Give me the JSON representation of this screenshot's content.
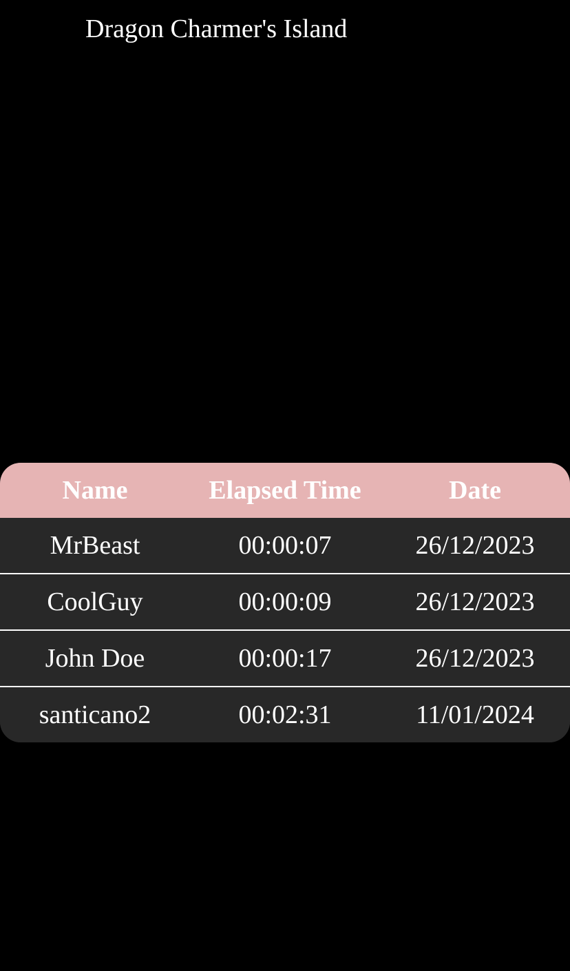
{
  "title": "Dragon Charmer's Island",
  "leaderboard": {
    "columns": {
      "name": "Name",
      "time": "Elapsed Time",
      "date": "Date"
    },
    "rows": [
      {
        "name": "MrBeast",
        "time": "00:00:07",
        "date": "26/12/2023"
      },
      {
        "name": "CoolGuy",
        "time": "00:00:09",
        "date": "26/12/2023"
      },
      {
        "name": "John Doe",
        "time": "00:00:17",
        "date": "26/12/2023"
      },
      {
        "name": "santicano2",
        "time": "00:02:31",
        "date": "11/01/2024"
      }
    ]
  },
  "colors": {
    "background": "#000000",
    "header_bg": "#e6b4b4",
    "row_bg": "#282828",
    "text": "#ffffff"
  }
}
